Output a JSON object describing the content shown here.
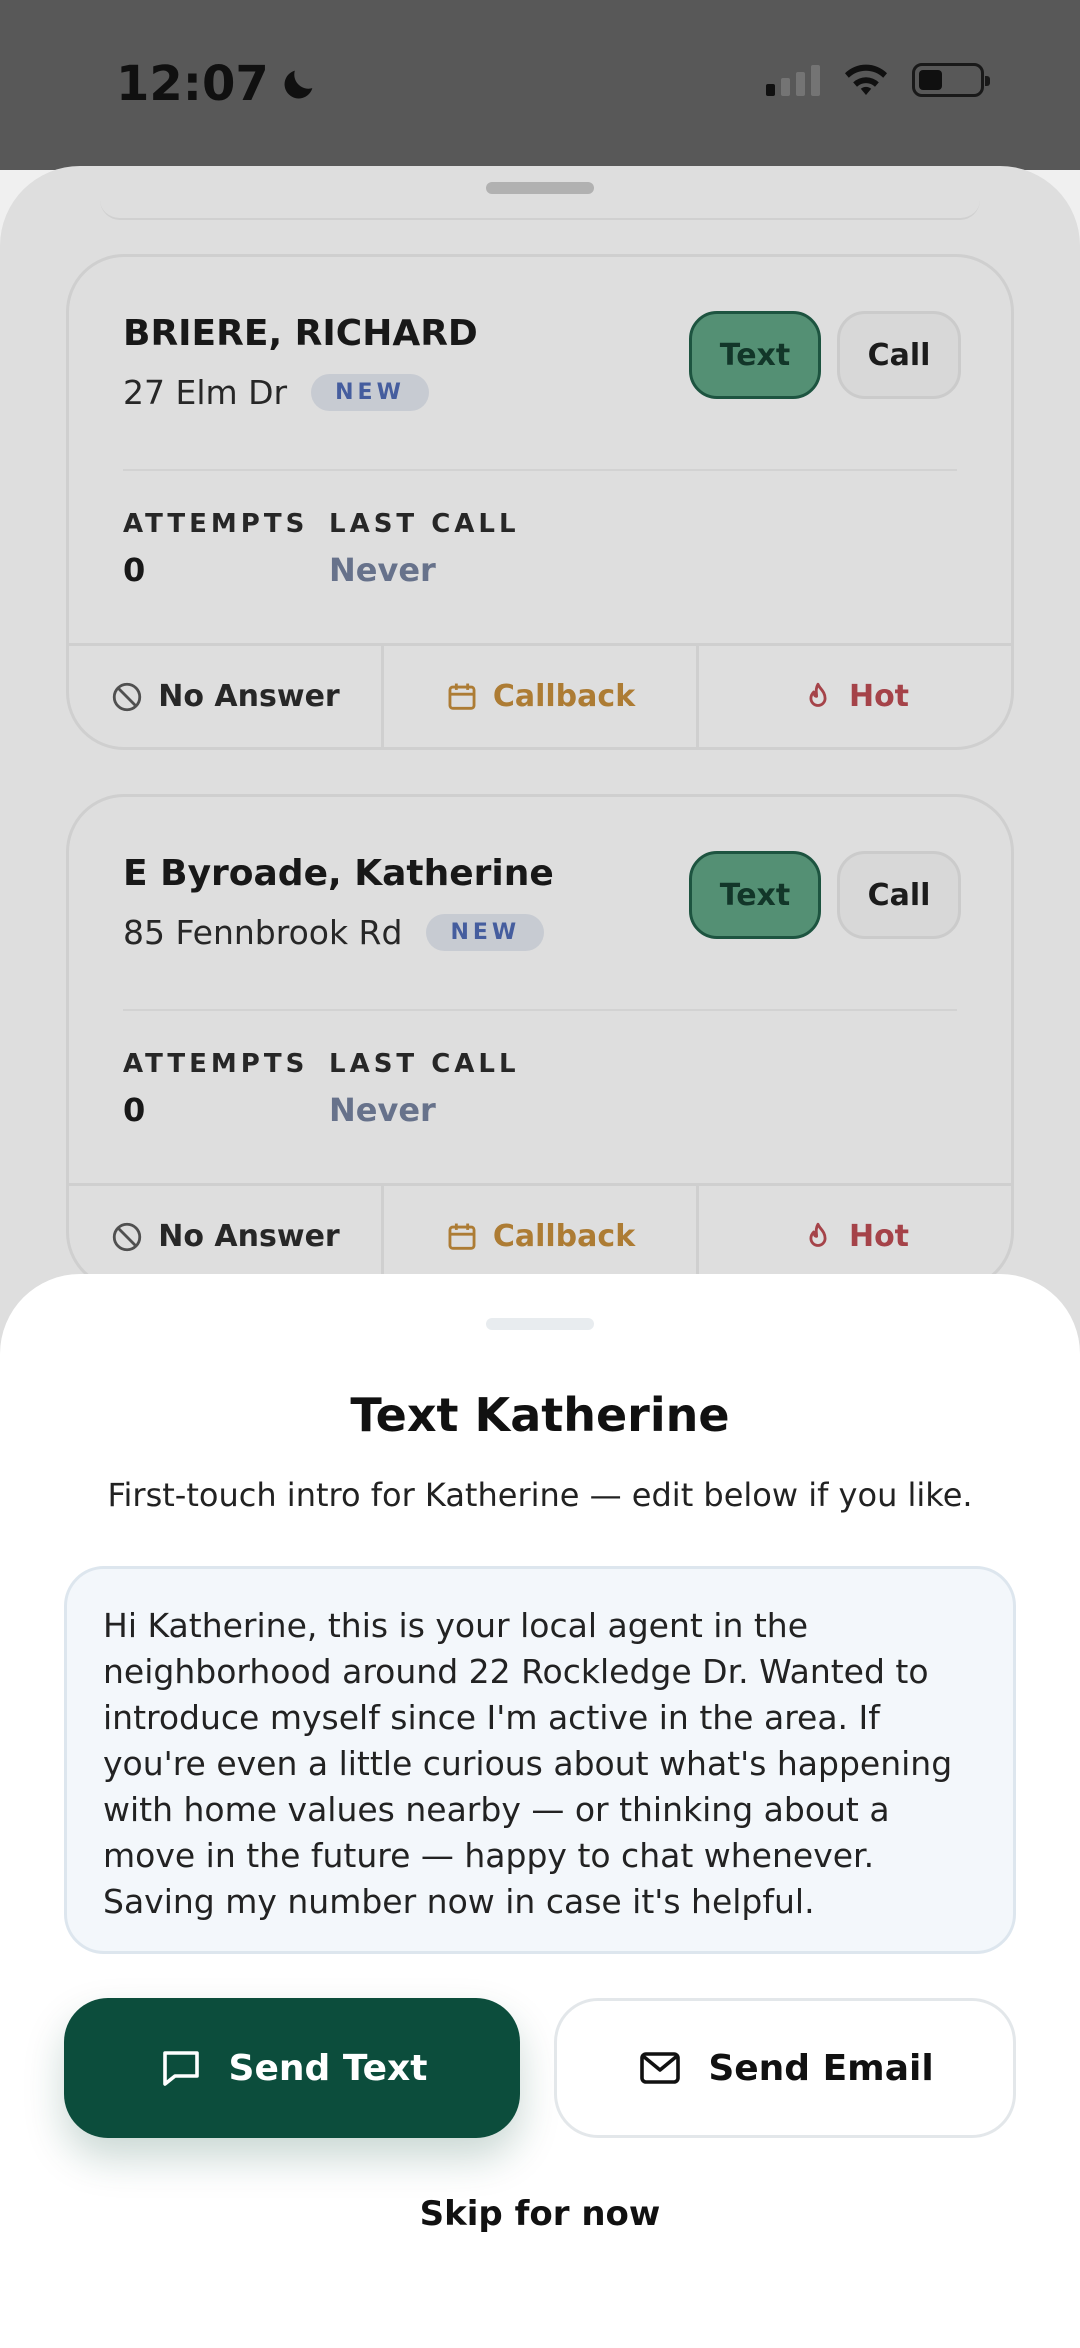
{
  "status_bar": {
    "time": "12:07",
    "icons": [
      "moon-icon",
      "signal-icon",
      "wifi-icon",
      "battery-icon"
    ]
  },
  "leads": [
    {
      "name": "BRIERE, RICHARD",
      "address": "27 Elm Dr",
      "badge": "NEW",
      "text_label": "Text",
      "call_label": "Call",
      "attempts_label": "ATTEMPTS",
      "attempts_value": "0",
      "last_call_label": "LAST CALL",
      "last_call_value": "Never",
      "actions": {
        "no_answer": "No Answer",
        "callback": "Callback",
        "hot": "Hot"
      }
    },
    {
      "name": "E Byroade, Katherine",
      "address": "85 Fennbrook Rd",
      "badge": "NEW",
      "text_label": "Text",
      "call_label": "Call",
      "attempts_label": "ATTEMPTS",
      "attempts_value": "0",
      "last_call_label": "LAST CALL",
      "last_call_value": "Never",
      "actions": {
        "no_answer": "No Answer",
        "callback": "Callback",
        "hot": "Hot"
      }
    }
  ],
  "modal": {
    "title": "Text Katherine",
    "subtitle": "First-touch intro for Katherine — edit below if you like.",
    "message": "Hi Katherine, this is your local agent in the neighborhood around 22 Rockledge Dr. Wanted to introduce myself since I'm active in the area. If you're even a little curious about what's happening with home values nearby — or thinking about a move in the future — happy to chat whenever. Saving my number now in case it's helpful.",
    "send_text_label": "Send Text",
    "send_email_label": "Send Email",
    "skip_label": "Skip for now"
  },
  "colors": {
    "primary": "#0c4d3c",
    "text_button_bg": "#5a9a7c",
    "badge_text": "#4a63a8",
    "callback": "#b88438",
    "hot": "#b0484e",
    "message_bg": "#f3f7fb"
  }
}
